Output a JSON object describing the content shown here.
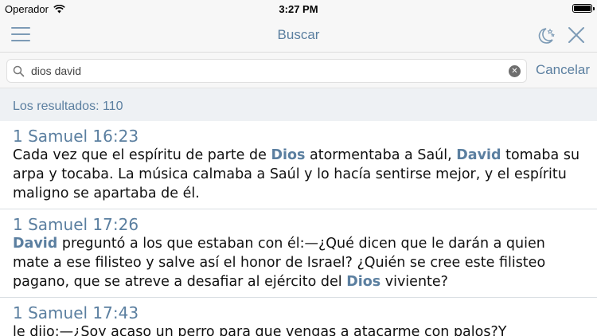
{
  "status": {
    "carrier": "Operador",
    "time": "3:27 PM"
  },
  "nav": {
    "title": "Buscar"
  },
  "search": {
    "query": "dios david",
    "cancel_label": "Cancelar"
  },
  "results_header": "Los resultados: 110",
  "results": [
    {
      "ref": "1 Samuel 16:23",
      "segments": [
        {
          "t": "Cada vez que el espíritu de parte de "
        },
        {
          "t": "Dios",
          "hl": true
        },
        {
          "t": " atormentaba a Saúl, "
        },
        {
          "t": "David",
          "hl": true
        },
        {
          "t": " tomaba su arpa y tocaba. La música calmaba a Saúl y lo hacía sentirse mejor, y el espíritu maligno se apartaba de él."
        }
      ]
    },
    {
      "ref": "1 Samuel 17:26",
      "segments": [
        {
          "t": "David",
          "hl": true
        },
        {
          "t": " preguntó a los que estaban con él:—¿Qué dicen que le darán a quien mate a ese filisteo y salve así el honor de Israel? ¿Quién se cree este filisteo pagano, que se atreve a desafiar al ejército del "
        },
        {
          "t": "Dios",
          "hl": true
        },
        {
          "t": " viviente?"
        }
      ]
    },
    {
      "ref": "1 Samuel 17:43",
      "segments": [
        {
          "t": "le dijo:—¿Soy acaso un perro para que vengas a atacarme con palos?Y"
        }
      ]
    }
  ]
}
